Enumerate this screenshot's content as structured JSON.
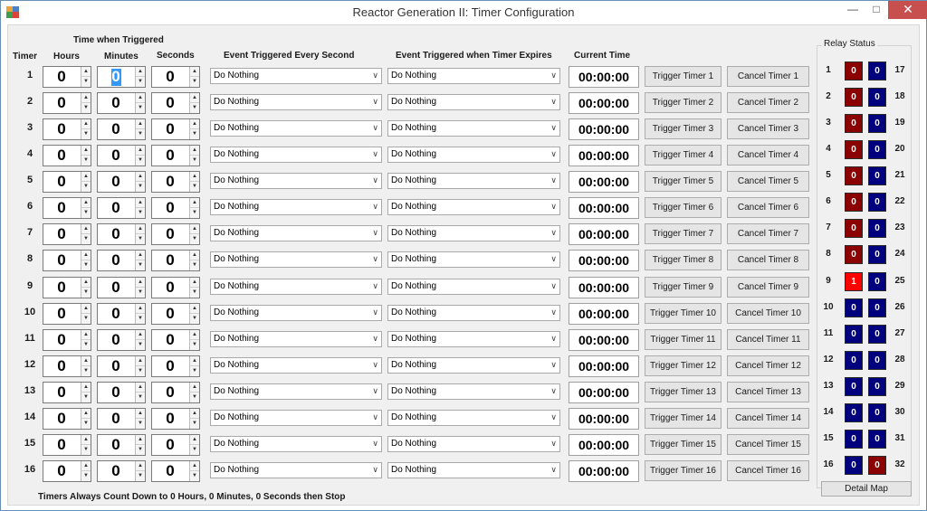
{
  "window": {
    "title": "Reactor Generation II: Timer Configuration",
    "min_glyph": "—",
    "max_glyph": "□",
    "close_glyph": "✕"
  },
  "headers": {
    "timer": "Timer",
    "time_group": "Time when Triggered",
    "hours": "Hours",
    "minutes": "Minutes",
    "seconds": "Seconds",
    "event_every_second": "Event Triggered Every Second",
    "event_expire": "Event Triggered when Timer Expires",
    "current_time": "Current Time"
  },
  "rows": [
    {
      "num": "1",
      "hours": "0",
      "minutes": "0",
      "seconds": "0",
      "event_second": "Do Nothing",
      "event_expire": "Do Nothing",
      "current": "00:00:00",
      "trigger": "Trigger Timer 1",
      "cancel": "Cancel Timer 1"
    },
    {
      "num": "2",
      "hours": "0",
      "minutes": "0",
      "seconds": "0",
      "event_second": "Do Nothing",
      "event_expire": "Do Nothing",
      "current": "00:00:00",
      "trigger": "Trigger Timer 2",
      "cancel": "Cancel Timer 2"
    },
    {
      "num": "3",
      "hours": "0",
      "minutes": "0",
      "seconds": "0",
      "event_second": "Do Nothing",
      "event_expire": "Do Nothing",
      "current": "00:00:00",
      "trigger": "Trigger Timer 3",
      "cancel": "Cancel Timer 3"
    },
    {
      "num": "4",
      "hours": "0",
      "minutes": "0",
      "seconds": "0",
      "event_second": "Do Nothing",
      "event_expire": "Do Nothing",
      "current": "00:00:00",
      "trigger": "Trigger Timer 4",
      "cancel": "Cancel Timer 4"
    },
    {
      "num": "5",
      "hours": "0",
      "minutes": "0",
      "seconds": "0",
      "event_second": "Do Nothing",
      "event_expire": "Do Nothing",
      "current": "00:00:00",
      "trigger": "Trigger Timer 5",
      "cancel": "Cancel Timer 5"
    },
    {
      "num": "6",
      "hours": "0",
      "minutes": "0",
      "seconds": "0",
      "event_second": "Do Nothing",
      "event_expire": "Do Nothing",
      "current": "00:00:00",
      "trigger": "Trigger Timer 6",
      "cancel": "Cancel Timer 6"
    },
    {
      "num": "7",
      "hours": "0",
      "minutes": "0",
      "seconds": "0",
      "event_second": "Do Nothing",
      "event_expire": "Do Nothing",
      "current": "00:00:00",
      "trigger": "Trigger Timer 7",
      "cancel": "Cancel Timer 7"
    },
    {
      "num": "8",
      "hours": "0",
      "minutes": "0",
      "seconds": "0",
      "event_second": "Do Nothing",
      "event_expire": "Do Nothing",
      "current": "00:00:00",
      "trigger": "Trigger Timer 8",
      "cancel": "Cancel Timer 8"
    },
    {
      "num": "9",
      "hours": "0",
      "minutes": "0",
      "seconds": "0",
      "event_second": "Do Nothing",
      "event_expire": "Do Nothing",
      "current": "00:00:00",
      "trigger": "Trigger Timer 9",
      "cancel": "Cancel Timer 9"
    },
    {
      "num": "10",
      "hours": "0",
      "minutes": "0",
      "seconds": "0",
      "event_second": "Do Nothing",
      "event_expire": "Do Nothing",
      "current": "00:00:00",
      "trigger": "Trigger Timer 10",
      "cancel": "Cancel Timer 10"
    },
    {
      "num": "11",
      "hours": "0",
      "minutes": "0",
      "seconds": "0",
      "event_second": "Do Nothing",
      "event_expire": "Do Nothing",
      "current": "00:00:00",
      "trigger": "Trigger Timer 11",
      "cancel": "Cancel Timer 11"
    },
    {
      "num": "12",
      "hours": "0",
      "minutes": "0",
      "seconds": "0",
      "event_second": "Do Nothing",
      "event_expire": "Do Nothing",
      "current": "00:00:00",
      "trigger": "Trigger Timer 12",
      "cancel": "Cancel Timer 12"
    },
    {
      "num": "13",
      "hours": "0",
      "minutes": "0",
      "seconds": "0",
      "event_second": "Do Nothing",
      "event_expire": "Do Nothing",
      "current": "00:00:00",
      "trigger": "Trigger Timer 13",
      "cancel": "Cancel Timer 13"
    },
    {
      "num": "14",
      "hours": "0",
      "minutes": "0",
      "seconds": "0",
      "event_second": "Do Nothing",
      "event_expire": "Do Nothing",
      "current": "00:00:00",
      "trigger": "Trigger Timer 14",
      "cancel": "Cancel Timer 14"
    },
    {
      "num": "15",
      "hours": "0",
      "minutes": "0",
      "seconds": "0",
      "event_second": "Do Nothing",
      "event_expire": "Do Nothing",
      "current": "00:00:00",
      "trigger": "Trigger Timer 15",
      "cancel": "Cancel Timer 15"
    },
    {
      "num": "16",
      "hours": "0",
      "minutes": "0",
      "seconds": "0",
      "event_second": "Do Nothing",
      "event_expire": "Do Nothing",
      "current": "00:00:00",
      "trigger": "Trigger Timer 16",
      "cancel": "Cancel Timer 16"
    }
  ],
  "selected_field": {
    "row": 0,
    "field": "minutes"
  },
  "footer_note": "Timers Always Count Down to 0 Hours, 0 Minutes, 0 Seconds then Stop",
  "relay_panel": {
    "title": "Relay Status",
    "detail_button": "Detail Map",
    "colors": {
      "left_off": "#8b0000",
      "left_on": "#ff0000",
      "right_off": "#00007f",
      "right_red": "#8b0000",
      "text": "#ffffff"
    },
    "rows": [
      {
        "left_num": "1",
        "left_val": "0",
        "right_val": "0",
        "right_num": "17",
        "left_color": "dark_red",
        "right_color": "dark_blue"
      },
      {
        "left_num": "2",
        "left_val": "0",
        "right_val": "0",
        "right_num": "18",
        "left_color": "dark_red",
        "right_color": "dark_blue"
      },
      {
        "left_num": "3",
        "left_val": "0",
        "right_val": "0",
        "right_num": "19",
        "left_color": "dark_red",
        "right_color": "dark_blue"
      },
      {
        "left_num": "4",
        "left_val": "0",
        "right_val": "0",
        "right_num": "20",
        "left_color": "dark_red",
        "right_color": "dark_blue"
      },
      {
        "left_num": "5",
        "left_val": "0",
        "right_val": "0",
        "right_num": "21",
        "left_color": "dark_red",
        "right_color": "dark_blue"
      },
      {
        "left_num": "6",
        "left_val": "0",
        "right_val": "0",
        "right_num": "22",
        "left_color": "dark_red",
        "right_color": "dark_blue"
      },
      {
        "left_num": "7",
        "left_val": "0",
        "right_val": "0",
        "right_num": "23",
        "left_color": "dark_red",
        "right_color": "dark_blue"
      },
      {
        "left_num": "8",
        "left_val": "0",
        "right_val": "0",
        "right_num": "24",
        "left_color": "dark_red",
        "right_color": "dark_blue"
      },
      {
        "left_num": "9",
        "left_val": "1",
        "right_val": "0",
        "right_num": "25",
        "left_color": "bright_red",
        "right_color": "dark_blue"
      },
      {
        "left_num": "10",
        "left_val": "0",
        "right_val": "0",
        "right_num": "26",
        "left_color": "dark_blue",
        "right_color": "dark_blue"
      },
      {
        "left_num": "11",
        "left_val": "0",
        "right_val": "0",
        "right_num": "27",
        "left_color": "dark_blue",
        "right_color": "dark_blue"
      },
      {
        "left_num": "12",
        "left_val": "0",
        "right_val": "0",
        "right_num": "28",
        "left_color": "dark_blue",
        "right_color": "dark_blue"
      },
      {
        "left_num": "13",
        "left_val": "0",
        "right_val": "0",
        "right_num": "29",
        "left_color": "dark_blue",
        "right_color": "dark_blue"
      },
      {
        "left_num": "14",
        "left_val": "0",
        "right_val": "0",
        "right_num": "30",
        "left_color": "dark_blue",
        "right_color": "dark_blue"
      },
      {
        "left_num": "15",
        "left_val": "0",
        "right_val": "0",
        "right_num": "31",
        "left_color": "dark_blue",
        "right_color": "dark_blue"
      },
      {
        "left_num": "16",
        "left_val": "0",
        "right_val": "0",
        "right_num": "32",
        "left_color": "dark_blue",
        "right_color": "dark_red"
      }
    ]
  }
}
